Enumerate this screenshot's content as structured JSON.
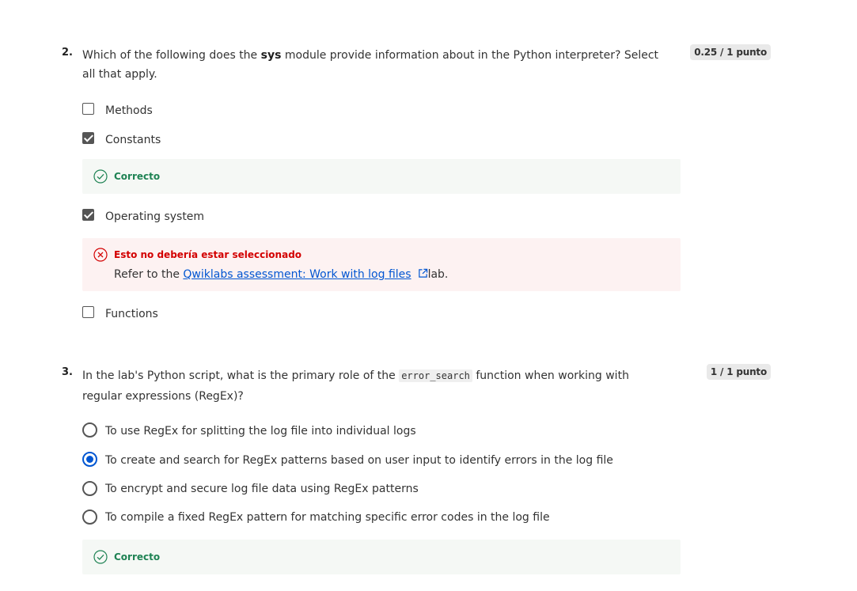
{
  "q2": {
    "number": "2.",
    "text_before": "Which of the following does the ",
    "text_bold": "sys",
    "text_after": " module provide information about in the Python interpreter? Select all that apply.",
    "score": "0.25 / 1 punto",
    "options": [
      {
        "label": "Methods",
        "checked": false
      },
      {
        "label": "Constants",
        "checked": true
      },
      {
        "label": "Operating system",
        "checked": true
      },
      {
        "label": "Functions",
        "checked": false
      }
    ],
    "feedback_correct": "Correcto",
    "feedback_wrong_title": "Esto no debería estar seleccionado",
    "feedback_wrong_prefix": "Refer to the ",
    "feedback_wrong_link": "Qwiklabs assessment: Work with log files",
    "feedback_wrong_suffix": "lab."
  },
  "q3": {
    "number": "3.",
    "text_before": "In the lab's Python script, what is the primary role of the ",
    "text_code": "error_search",
    "text_after": " function when working with regular expressions (RegEx)?",
    "score": "1 / 1 punto",
    "options": [
      {
        "label": "To use RegEx for splitting the log file into individual logs",
        "selected": false
      },
      {
        "label": "To create and search for RegEx patterns based on user input to identify errors in the log file",
        "selected": true
      },
      {
        "label": "To encrypt and secure log file data using RegEx patterns",
        "selected": false
      },
      {
        "label": "To compile a fixed RegEx pattern for matching specific error codes in the log file",
        "selected": false
      }
    ],
    "feedback_correct": "Correcto"
  },
  "colors": {
    "accent": "#0056d2",
    "correct": "#1f8354",
    "error": "#d30001"
  },
  "icons": {
    "correct": "check-circle-icon",
    "wrong": "x-circle-icon",
    "external": "external-link-icon"
  }
}
